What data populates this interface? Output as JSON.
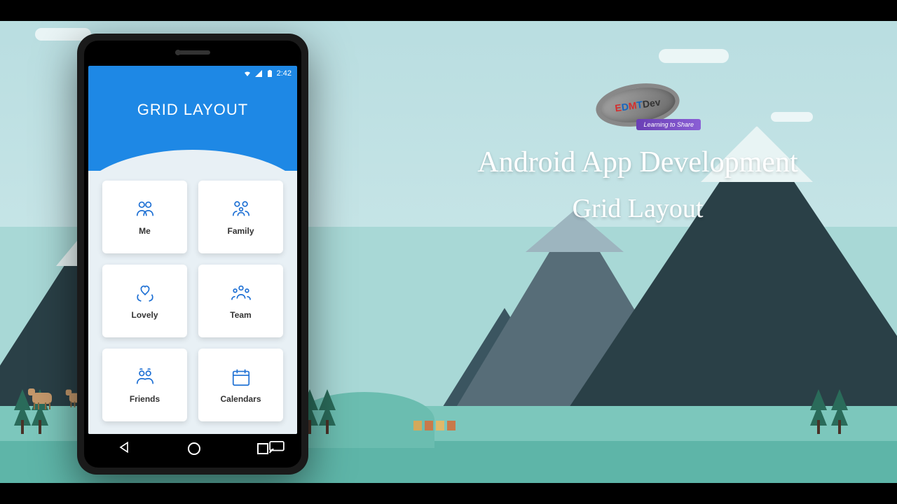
{
  "statusbar": {
    "time": "2:42"
  },
  "header": {
    "title": "GRID LAYOUT"
  },
  "cards": [
    {
      "label": "Me",
      "icon": "people-icon"
    },
    {
      "label": "Family",
      "icon": "family-icon"
    },
    {
      "label": "Lovely",
      "icon": "heart-hands-icon"
    },
    {
      "label": "Team",
      "icon": "team-icon"
    },
    {
      "label": "Friends",
      "icon": "friends-icon"
    },
    {
      "label": "Calendars",
      "icon": "calendar-icon"
    }
  ],
  "brand": {
    "name_parts": [
      "E",
      "D",
      "M",
      "T",
      "Dev"
    ],
    "tagline": "Learning to Share"
  },
  "headline": {
    "line1": "Android App Development",
    "line2": "Grid Layout"
  }
}
